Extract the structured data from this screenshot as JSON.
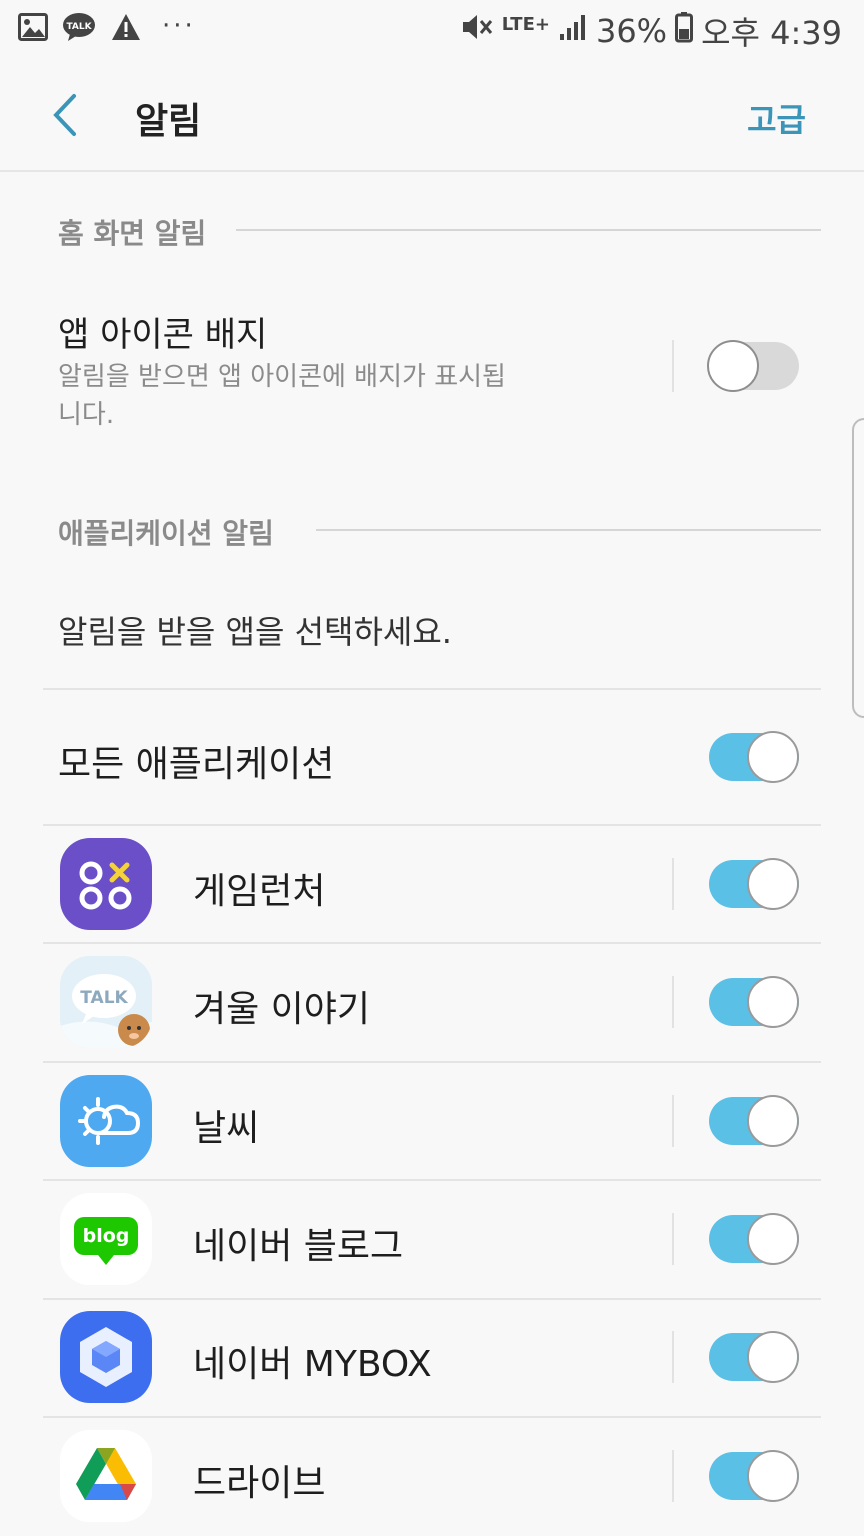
{
  "status_bar": {
    "icons_left": [
      "gallery-icon",
      "kakaotalk-icon",
      "warning-icon"
    ],
    "talk_badge": "TALK",
    "more": "···",
    "network": "LTE+",
    "battery_percent": "36%",
    "time": "오후 4:39"
  },
  "app_bar": {
    "title": "알림",
    "advanced_label": "고급"
  },
  "home_section": {
    "header": "홈 화면 알림",
    "badge_title": "앱 아이콘 배지",
    "badge_description": "알림을 받으면 앱 아이콘에 배지가 표시됩니다.",
    "badge_enabled": false
  },
  "app_section": {
    "header": "애플리케이션 알림",
    "instruction": "알림을 받을 앱을 선택하세요.",
    "all_apps_label": "모든 애플리케이션",
    "all_apps_enabled": true
  },
  "apps": [
    {
      "name": "게임런처",
      "icon": "game-launcher-icon",
      "enabled": true
    },
    {
      "name": "겨울 이야기",
      "icon": "talk-theme-icon",
      "icon_text": "TALK",
      "enabled": true
    },
    {
      "name": "날씨",
      "icon": "weather-icon",
      "enabled": true
    },
    {
      "name": "네이버 블로그",
      "icon": "naver-blog-icon",
      "icon_text": "blog",
      "enabled": true
    },
    {
      "name": "네이버 MYBOX",
      "icon": "naver-mybox-icon",
      "enabled": true
    },
    {
      "name": "드라이브",
      "icon": "google-drive-icon",
      "enabled": true
    }
  ],
  "colors": {
    "accent": "#3a95b8",
    "toggle_on": "#5bc0e6",
    "toggle_off": "#d9d9d9"
  }
}
